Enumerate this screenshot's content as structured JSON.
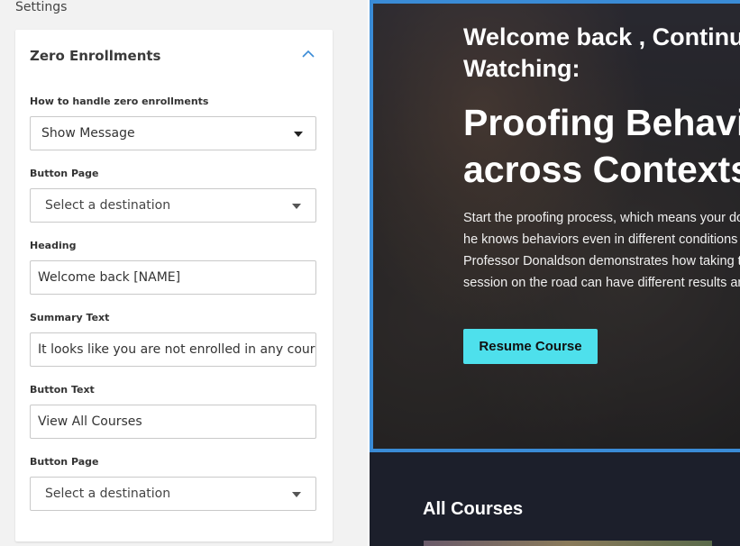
{
  "settings": {
    "title": "Settings",
    "section_title": "Zero Enrollments",
    "fields": [
      {
        "label": "How to handle zero enrollments",
        "value": "Show Message"
      },
      {
        "label": "Button Page",
        "placeholder": "Select a destination"
      },
      {
        "label": "Heading",
        "value": "Welcome back [NAME]"
      },
      {
        "label": "Summary Text",
        "value": "It looks like you are not enrolled in any courses"
      },
      {
        "label": "Button Text",
        "value": "View All Courses"
      },
      {
        "label": "Button Page",
        "placeholder": "Select a destination"
      }
    ]
  },
  "preview": {
    "welcome": "Welcome back , Continue Watching:",
    "course_title": "Proofing Behaviors across Contexts",
    "description": "Start the proofing process, which means your dog will be proving he knows behaviors even in different conditions or environments. Professor Donaldson demonstrates how taking the same training session on the road can have different results and why.",
    "resume_button": "Resume Course",
    "all_courses": "All Courses"
  },
  "colors": {
    "accent": "#4ee0ec",
    "hero_border": "#3a8bd6",
    "dark_bg": "#1c1f2b"
  }
}
